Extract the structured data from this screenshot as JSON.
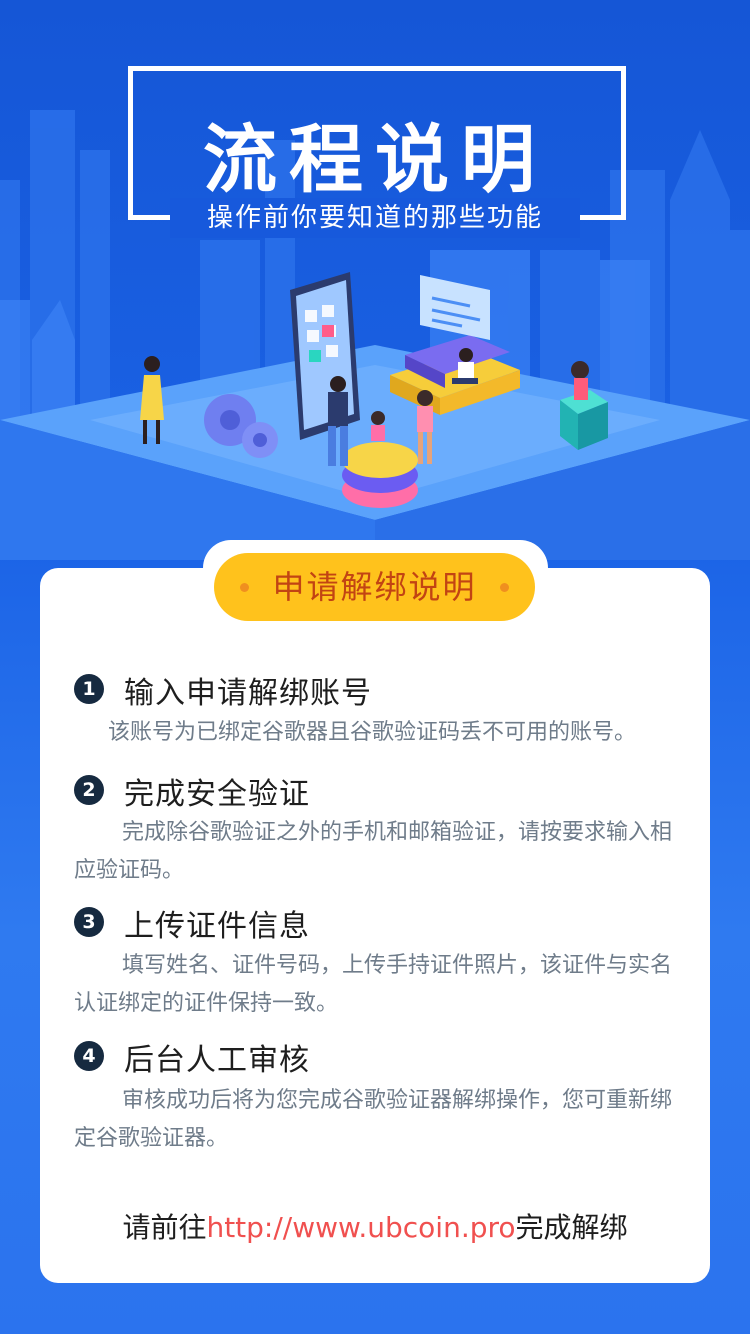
{
  "header": {
    "title": "流程说明",
    "subtitle": "操作前你要知道的那些功能"
  },
  "section": {
    "label": "申请解绑说明"
  },
  "steps": [
    {
      "num": "1",
      "title": "输入申请解绑账号",
      "desc": "该账号为已绑定谷歌器且谷歌验证码丢不可用的账号。"
    },
    {
      "num": "2",
      "title": "完成安全验证",
      "desc": "完成除谷歌验证之外的手机和邮箱验证，请按要求输入相应验证码。"
    },
    {
      "num": "3",
      "title": "上传证件信息",
      "desc": "填写姓名、证件号码，上传手持证件照片，该证件与实名认证绑定的证件保持一致。"
    },
    {
      "num": "4",
      "title": "后台人工审核",
      "desc": "审核成功后将为您完成谷歌验证器解绑操作，您可重新绑定谷歌验证器。"
    }
  ],
  "footer": {
    "prefix": "请前往",
    "link": "http://www.ubcoin.pro",
    "suffix": "完成解绑"
  },
  "colors": {
    "background": "#1b63e6",
    "accent_pill": "#ffc21c",
    "pill_text": "#c24413",
    "link": "#f0504f",
    "step_badge": "#162a40"
  }
}
